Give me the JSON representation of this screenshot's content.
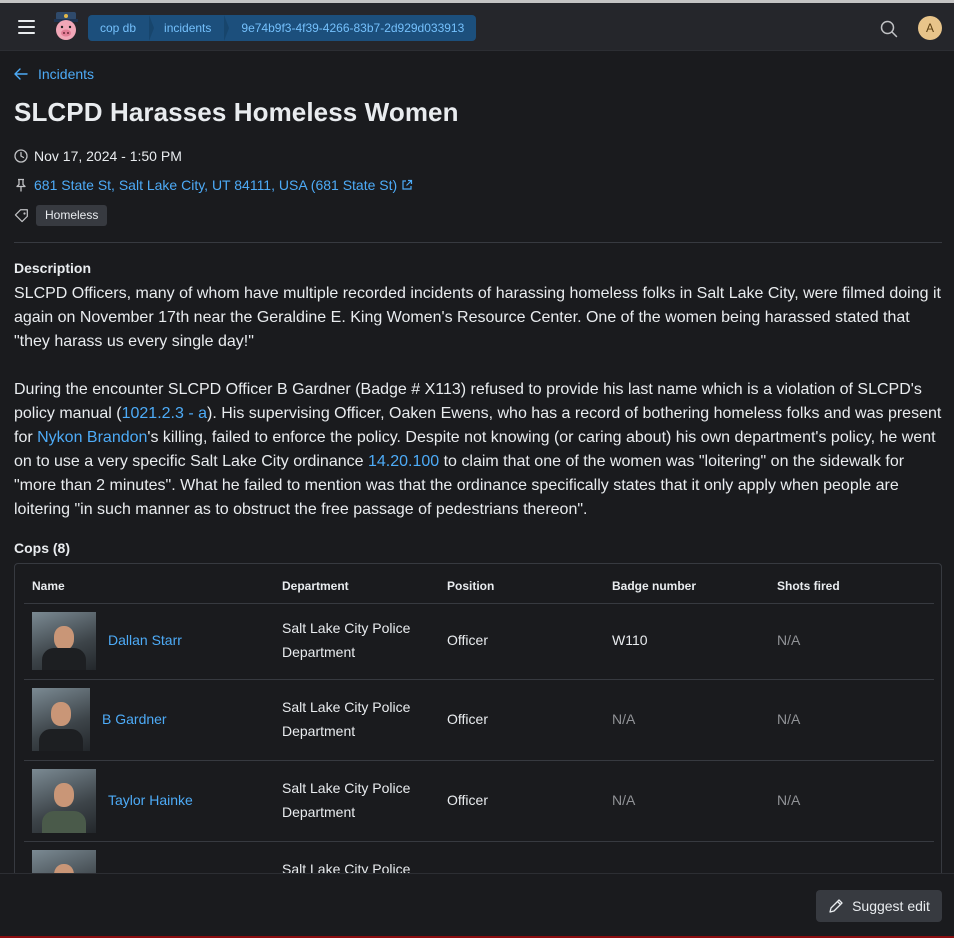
{
  "header": {
    "breadcrumbs": [
      "cop db",
      "incidents",
      "9e74b9f3-4f39-4266-83b7-2d929d033913"
    ],
    "avatar_initial": "A"
  },
  "back_link": "Incidents",
  "incident": {
    "title": "SLCPD Harasses Homeless Women",
    "datetime": "Nov 17, 2024 - 1:50 PM",
    "address": "681 State St, Salt Lake City, UT 84111, USA (681 State St)",
    "tags": [
      "Homeless"
    ]
  },
  "description": {
    "label": "Description",
    "p1": "SLCPD Officers, many of whom have multiple recorded incidents of harassing homeless folks in Salt Lake City, were filmed doing it again on November 17th near the Geraldine E. King Women's Resource Center. One of the women being harassed stated that \"they harass us every single day!\"",
    "p2_a": "During the encounter SLCPD Officer B Gardner (Badge # X113) refused to provide his last name which is a violation of SLCPD's policy manual (",
    "p2_link1": "1021.2.3 - a",
    "p2_b": "). His supervising Officer, Oaken Ewens, who has a record of bothering homeless folks and was present for ",
    "p2_link2": "Nykon Brandon",
    "p2_c": "'s killing, failed to enforce the policy. Despite not knowing (or caring about) his own department's policy, he went on to use a very specific Salt Lake City ordinance ",
    "p2_link3": "14.20.100",
    "p2_d": " to claim that one of the women was \"loitering\" on the sidewalk for \"more than 2 minutes\". What he failed to mention was that the ordinance specifically states that it only apply when people are loitering \"in such manner as to obstruct the free passage of pedestrians thereon\"."
  },
  "cops": {
    "label": "Cops (8)",
    "columns": [
      "Name",
      "Department",
      "Position",
      "Badge number",
      "Shots fired"
    ],
    "rows": [
      {
        "name": "Dallan Starr",
        "dept_line1": "Salt Lake City Police",
        "dept_line2": "Department",
        "position": "Officer",
        "badge": "W110",
        "shots": "N/A"
      },
      {
        "name": "B Gardner",
        "dept_line1": "Salt Lake City Police",
        "dept_line2": "Department",
        "position": "Officer",
        "badge": "N/A",
        "shots": "N/A"
      },
      {
        "name": "Taylor Hainke",
        "dept_line1": "Salt Lake City Police",
        "dept_line2": "Department",
        "position": "Officer",
        "badge": "N/A",
        "shots": "N/A"
      },
      {
        "dept_line1": "Salt Lake City Police"
      }
    ]
  },
  "footer": {
    "suggest_label": "Suggest edit"
  }
}
